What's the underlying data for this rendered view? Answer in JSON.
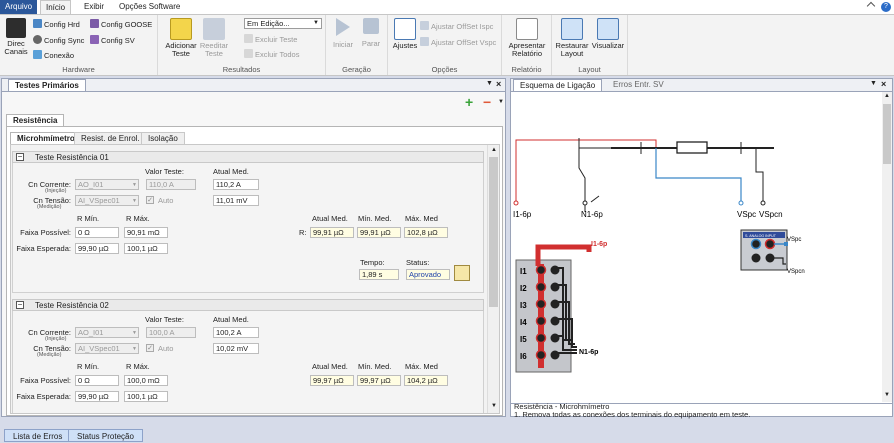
{
  "menu": {
    "file": "Arquivo",
    "home": "Início",
    "view": "Exibir",
    "software": "Opções Software"
  },
  "ribbon": {
    "direct_channels": "Direc\nCanais",
    "config_hrd": "Config Hrd",
    "config_sync": "Config Sync",
    "connection": "Conexão",
    "config_goose": "Config GOOSE",
    "config_sv": "Config SV",
    "hardware_group": "Hardware",
    "add_test": "Adicionar\nTeste",
    "edit_test": "Reeditar\nTeste",
    "edit_mode": "Em Edição...",
    "delete_test": "Excluir Teste",
    "delete_all": "Excluir Todos",
    "results_group": "Resultados",
    "start": "Iniciar",
    "stop": "Parar",
    "generation_group": "Geração",
    "settings": "Ajustes",
    "offset_ispc": "Ajustar OffSet Ispc",
    "offset_vspc": "Ajustar OffSet Vspc",
    "options_group": "Opções",
    "present_report": "Apresentar\nRelatório",
    "report_group": "Relatório",
    "restore_layout": "Restaurar\nLayout",
    "view_btn": "Visualizar",
    "layout_group": "Layout"
  },
  "left_panel": {
    "tab": "Testes Primários",
    "section": "Resistência",
    "subtabs": [
      "Microhmímetro",
      "Resist. de Enrol.",
      "Isolação"
    ],
    "tests": [
      {
        "title": "Teste Resistência 01",
        "val_test_hdr": "Valor Teste:",
        "meas_hdr": "Atual Med.",
        "cn_current": "Cn Corrente:",
        "injection": "(Injeção)",
        "current_ch": "AO_I01",
        "current_val": "110,0 A",
        "current_meas": "110,2 A",
        "cn_voltage": "Cn Tensão:",
        "measurement": "(Medição)",
        "voltage_ch": "AI_VSpec01",
        "auto": "Auto",
        "voltage_meas": "11,01 mV",
        "rmin_hdr": "R Mín.",
        "rmax_hdr": "R Máx.",
        "faixa_possivel": "Faixa Possível:",
        "fp_min": "0 Ω",
        "fp_max": "90,91 mΩ",
        "faixa_esperada": "Faixa Esperada:",
        "fe_min": "99,90 µΩ",
        "fe_max": "100,1 µΩ",
        "r_label": "R:",
        "meas_hdr2": "Atual Med.",
        "min_hdr": "Mín. Med.",
        "max_hdr": "Máx. Med",
        "r_meas": "99,91 µΩ",
        "r_min": "99,91 µΩ",
        "r_max": "102,8 µΩ",
        "time_label": "Tempo:",
        "status_label": "Status:",
        "time_val": "1,89 s",
        "status_val": "Aprovado"
      },
      {
        "title": "Teste Resistência 02",
        "val_test_hdr": "Valor Teste:",
        "meas_hdr": "Atual Med.",
        "cn_current": "Cn Corrente:",
        "injection": "(Injeção)",
        "current_ch": "AO_I01",
        "current_val": "100,0 A",
        "current_meas": "100,2 A",
        "cn_voltage": "Cn Tensão:",
        "measurement": "(Medição)",
        "voltage_ch": "AI_VSpec01",
        "auto": "Auto",
        "voltage_meas": "10,02 mV",
        "rmin_hdr": "R Mín.",
        "rmax_hdr": "R Máx.",
        "faixa_possivel": "Faixa Possível:",
        "fp_min": "0 Ω",
        "fp_max": "100,0 mΩ",
        "faixa_esperada": "Faixa Esperada:",
        "fe_min": "99,90 µΩ",
        "fe_max": "100,1 µΩ",
        "meas_hdr2": "Atual Med.",
        "min_hdr": "Mín. Med.",
        "max_hdr": "Máx. Med",
        "r_meas": "99,97 µΩ",
        "r_min": "99,97 µΩ",
        "r_max": "104,2 µΩ"
      }
    ]
  },
  "right_panel": {
    "tab1": "Esquema de Ligação",
    "tab2": "Erros Entr. SV",
    "labels": {
      "i1": "I1-6p",
      "n1": "N1-6p",
      "vspc": "VSpc",
      "vspcn": "VSpcn",
      "i1b": "I1-6p",
      "n1b": "N1-6p",
      "ai_title": "S. ANALOG INPUT",
      "ai_vspc": "VSpc",
      "ai_vspcn": "VSpcn"
    },
    "channels": [
      "I1",
      "I2",
      "I3",
      "I4",
      "I5",
      "I6"
    ],
    "info_title": "Resistência - Microhmímetro",
    "info_text": "1. Remova todas as conexões dos terminais do equipamento em teste."
  },
  "bottom_tabs": [
    "Lista de Erros",
    "Status Proteção"
  ],
  "colors": {
    "accent": "#2b579a",
    "current": "#d12f2f",
    "voltage": "#3a87c8"
  }
}
